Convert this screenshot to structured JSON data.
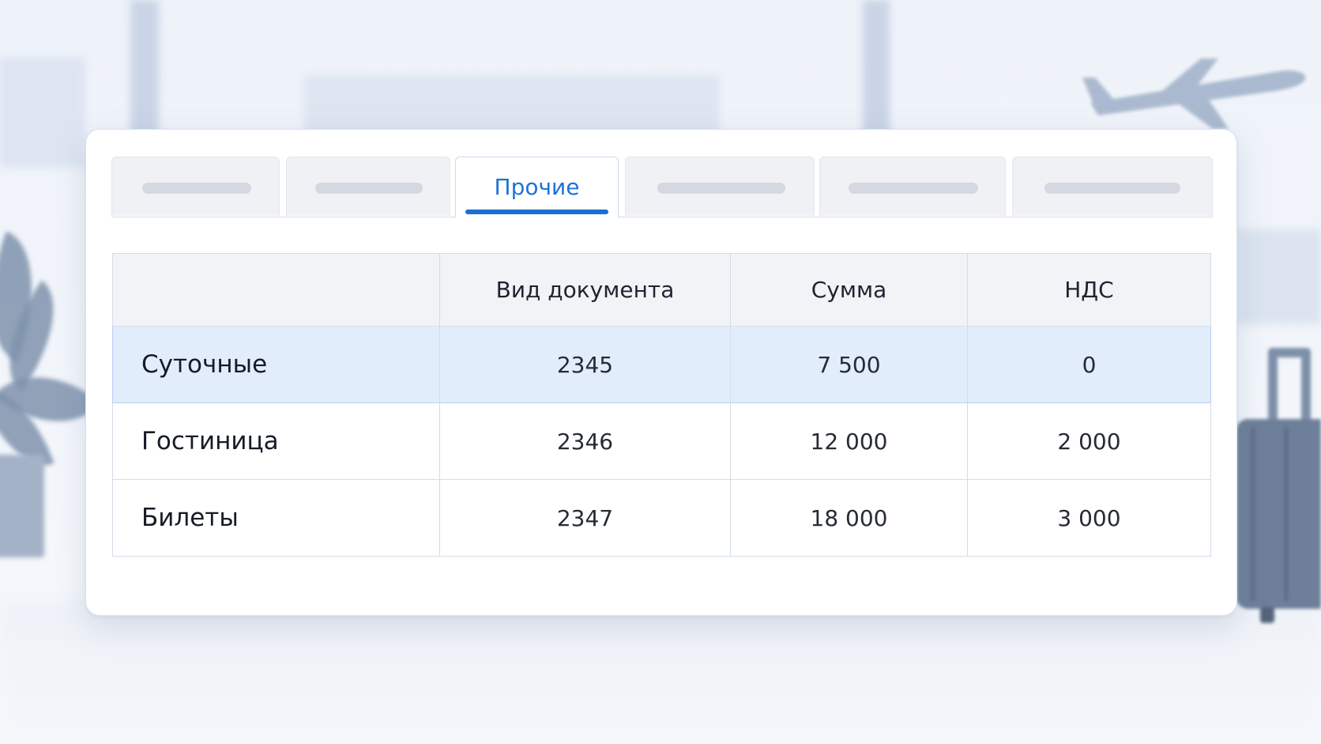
{
  "tabs": [
    {
      "label": "",
      "active": false
    },
    {
      "label": "",
      "active": false
    },
    {
      "label": "Прочие",
      "active": true
    },
    {
      "label": "",
      "active": false
    },
    {
      "label": "",
      "active": false
    },
    {
      "label": "",
      "active": false
    }
  ],
  "table": {
    "headers": [
      "",
      "Вид документа",
      "Сумма",
      "НДС"
    ],
    "rows": [
      {
        "label": "Суточные",
        "doc_type": "2345",
        "amount": "7 500",
        "vat": "0",
        "selected": true
      },
      {
        "label": "Гостиница",
        "doc_type": "2346",
        "amount": "12 000",
        "vat": "2 000",
        "selected": false
      },
      {
        "label": "Билеты",
        "doc_type": "2347",
        "amount": "18 000",
        "vat": "3 000",
        "selected": false
      }
    ]
  },
  "colors": {
    "accent": "#1f73d6",
    "selected_row": "#e2edfc",
    "header_bg": "#f1f3f7",
    "tab_inactive": "#eff1f5"
  },
  "icons": [
    "airplane-icon",
    "suitcase-icon",
    "plant-icon"
  ]
}
